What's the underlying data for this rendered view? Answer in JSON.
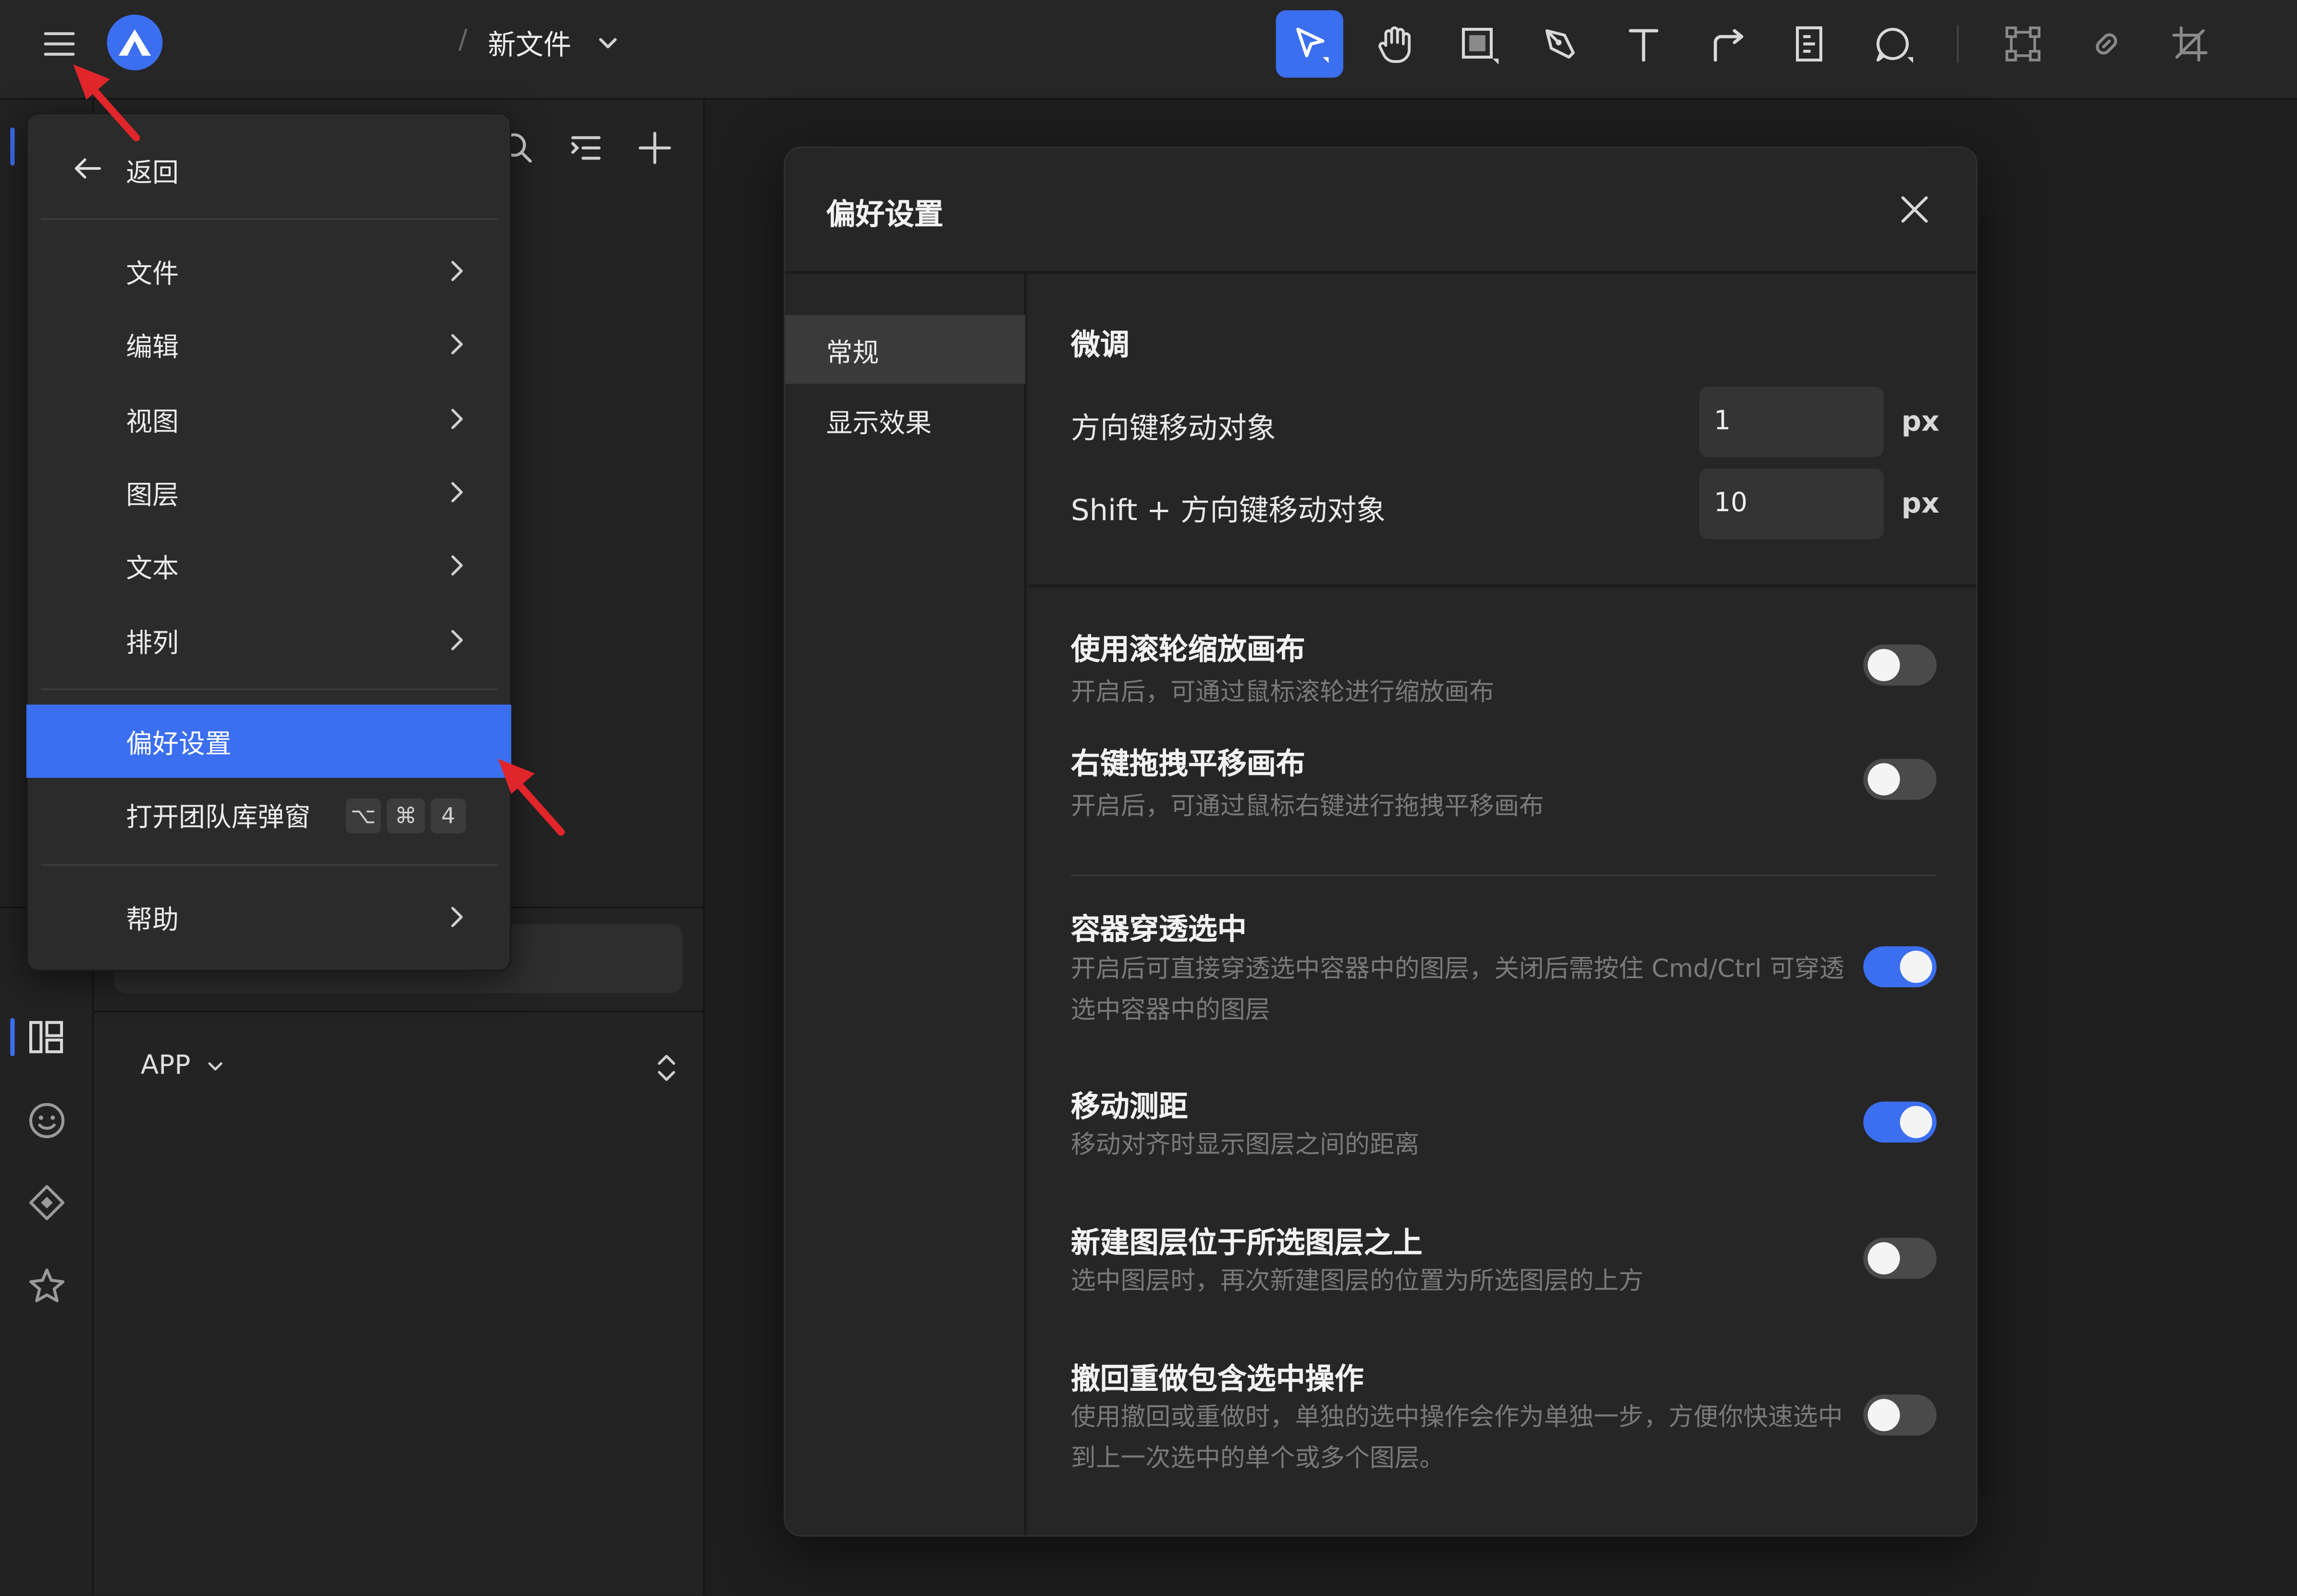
{
  "topbar": {
    "filename": "新文件",
    "tools": [
      "select-tool",
      "hand-tool",
      "frame-tool",
      "pen-tool",
      "text-tool",
      "connector-tool",
      "component-tool",
      "comment-tool",
      "vector-bounds-tool",
      "link-tool",
      "crop-tool"
    ]
  },
  "menu": {
    "back": "返回",
    "items": [
      "文件",
      "编辑",
      "视图",
      "图层",
      "文本",
      "排列"
    ],
    "preferences": "偏好设置",
    "team_library": "打开团队库弹窗",
    "shortcut_keys": [
      "⌥",
      "⌘",
      "4"
    ],
    "help": "帮助"
  },
  "sidebar": {
    "app_select": "APP"
  },
  "dialog": {
    "title": "偏好设置",
    "nav": [
      "常规",
      "显示效果"
    ],
    "section_title": "微调",
    "nudge": {
      "label": "方向键移动对象",
      "value": "1",
      "unit": "px"
    },
    "shift_nudge": {
      "label": "Shift + 方向键移动对象",
      "value": "10",
      "unit": "px"
    },
    "options": [
      {
        "title": "使用滚轮缩放画布",
        "desc": "开启后，可通过鼠标滚轮进行缩放画布",
        "on": false
      },
      {
        "title": "右键拖拽平移画布",
        "desc": "开启后，可通过鼠标右键进行拖拽平移画布",
        "on": false
      },
      {
        "title": "容器穿透选中",
        "desc": "开启后可直接穿透选中容器中的图层，关闭后需按住 Cmd/Ctrl 可穿透选中容器中的图层",
        "on": true
      },
      {
        "title": "移动测距",
        "desc": "移动对齐时显示图层之间的距离",
        "on": true
      },
      {
        "title": "新建图层位于所选图层之上",
        "desc": "选中图层时，再次新建图层的位置为所选图层的上方",
        "on": false
      },
      {
        "title": "撤回重做包含选中操作",
        "desc": "使用撤回或重做时，单独的选中操作会作为单独一步，方便你快速选中到上一次选中的单个或多个图层。",
        "on": false
      }
    ]
  },
  "colors": {
    "accent": "#3b6ff0",
    "annotation_arrow": "#e0262b",
    "background": "#1e1e1e"
  }
}
